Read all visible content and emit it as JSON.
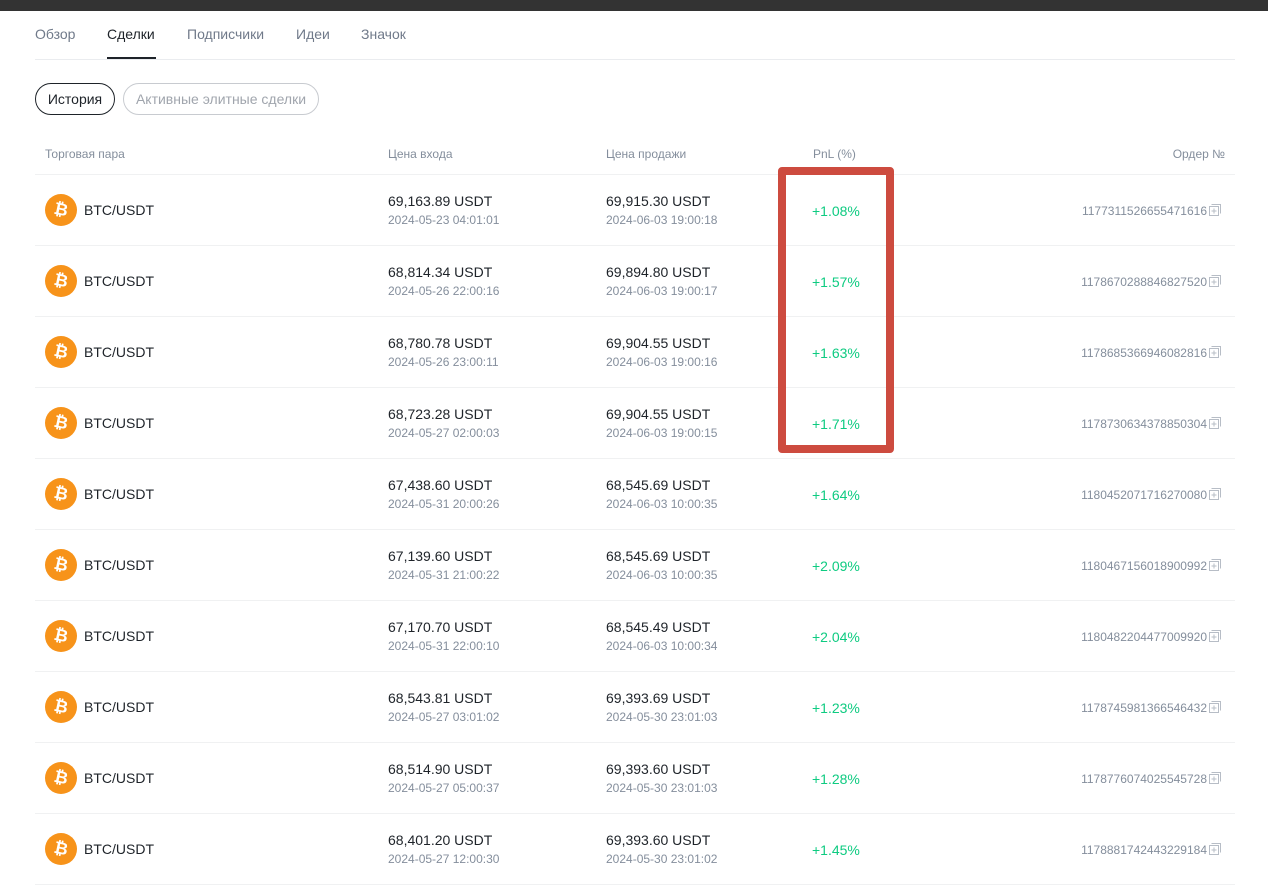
{
  "tabs": [
    {
      "label": "Обзор"
    },
    {
      "label": "Сделки",
      "active": true
    },
    {
      "label": "Подписчики"
    },
    {
      "label": "Идеи"
    },
    {
      "label": "Значок"
    }
  ],
  "filters": {
    "history": "История",
    "active_elite": "Активные элитные сделки"
  },
  "columns": {
    "pair": "Торговая пара",
    "entry": "Цена входа",
    "exit": "Цена продажи",
    "pnl": "PnL (%)",
    "order": "Ордер №"
  },
  "colors": {
    "coin": "#f7931a",
    "pnl_positive": "#0ecb81",
    "highlight_box": "#cd4b3f"
  },
  "coin_icon": "bitcoin-icon",
  "rows": [
    {
      "pair": "BTC/USDT",
      "entry_price": "69,163.89 USDT",
      "entry_time": "2024-05-23 04:01:01",
      "exit_price": "69,915.30 USDT",
      "exit_time": "2024-06-03 19:00:18",
      "pnl": "+1.08%",
      "order": "1177311526655471616"
    },
    {
      "pair": "BTC/USDT",
      "entry_price": "68,814.34 USDT",
      "entry_time": "2024-05-26 22:00:16",
      "exit_price": "69,894.80 USDT",
      "exit_time": "2024-06-03 19:00:17",
      "pnl": "+1.57%",
      "order": "1178670288846827520"
    },
    {
      "pair": "BTC/USDT",
      "entry_price": "68,780.78 USDT",
      "entry_time": "2024-05-26 23:00:11",
      "exit_price": "69,904.55 USDT",
      "exit_time": "2024-06-03 19:00:16",
      "pnl": "+1.63%",
      "order": "1178685366946082816"
    },
    {
      "pair": "BTC/USDT",
      "entry_price": "68,723.28 USDT",
      "entry_time": "2024-05-27 02:00:03",
      "exit_price": "69,904.55 USDT",
      "exit_time": "2024-06-03 19:00:15",
      "pnl": "+1.71%",
      "order": "1178730634378850304"
    },
    {
      "pair": "BTC/USDT",
      "entry_price": "67,438.60 USDT",
      "entry_time": "2024-05-31 20:00:26",
      "exit_price": "68,545.69 USDT",
      "exit_time": "2024-06-03 10:00:35",
      "pnl": "+1.64%",
      "order": "1180452071716270080"
    },
    {
      "pair": "BTC/USDT",
      "entry_price": "67,139.60 USDT",
      "entry_time": "2024-05-31 21:00:22",
      "exit_price": "68,545.69 USDT",
      "exit_time": "2024-06-03 10:00:35",
      "pnl": "+2.09%",
      "order": "1180467156018900992"
    },
    {
      "pair": "BTC/USDT",
      "entry_price": "67,170.70 USDT",
      "entry_time": "2024-05-31 22:00:10",
      "exit_price": "68,545.49 USDT",
      "exit_time": "2024-06-03 10:00:34",
      "pnl": "+2.04%",
      "order": "1180482204477009920"
    },
    {
      "pair": "BTC/USDT",
      "entry_price": "68,543.81 USDT",
      "entry_time": "2024-05-27 03:01:02",
      "exit_price": "69,393.69 USDT",
      "exit_time": "2024-05-30 23:01:03",
      "pnl": "+1.23%",
      "order": "1178745981366546432"
    },
    {
      "pair": "BTC/USDT",
      "entry_price": "68,514.90 USDT",
      "entry_time": "2024-05-27 05:00:37",
      "exit_price": "69,393.60 USDT",
      "exit_time": "2024-05-30 23:01:03",
      "pnl": "+1.28%",
      "order": "1178776074025545728"
    },
    {
      "pair": "BTC/USDT",
      "entry_price": "68,401.20 USDT",
      "entry_time": "2024-05-27 12:00:30",
      "exit_price": "69,393.60 USDT",
      "exit_time": "2024-05-30 23:01:02",
      "pnl": "+1.45%",
      "order": "1178881742443229184"
    }
  ]
}
